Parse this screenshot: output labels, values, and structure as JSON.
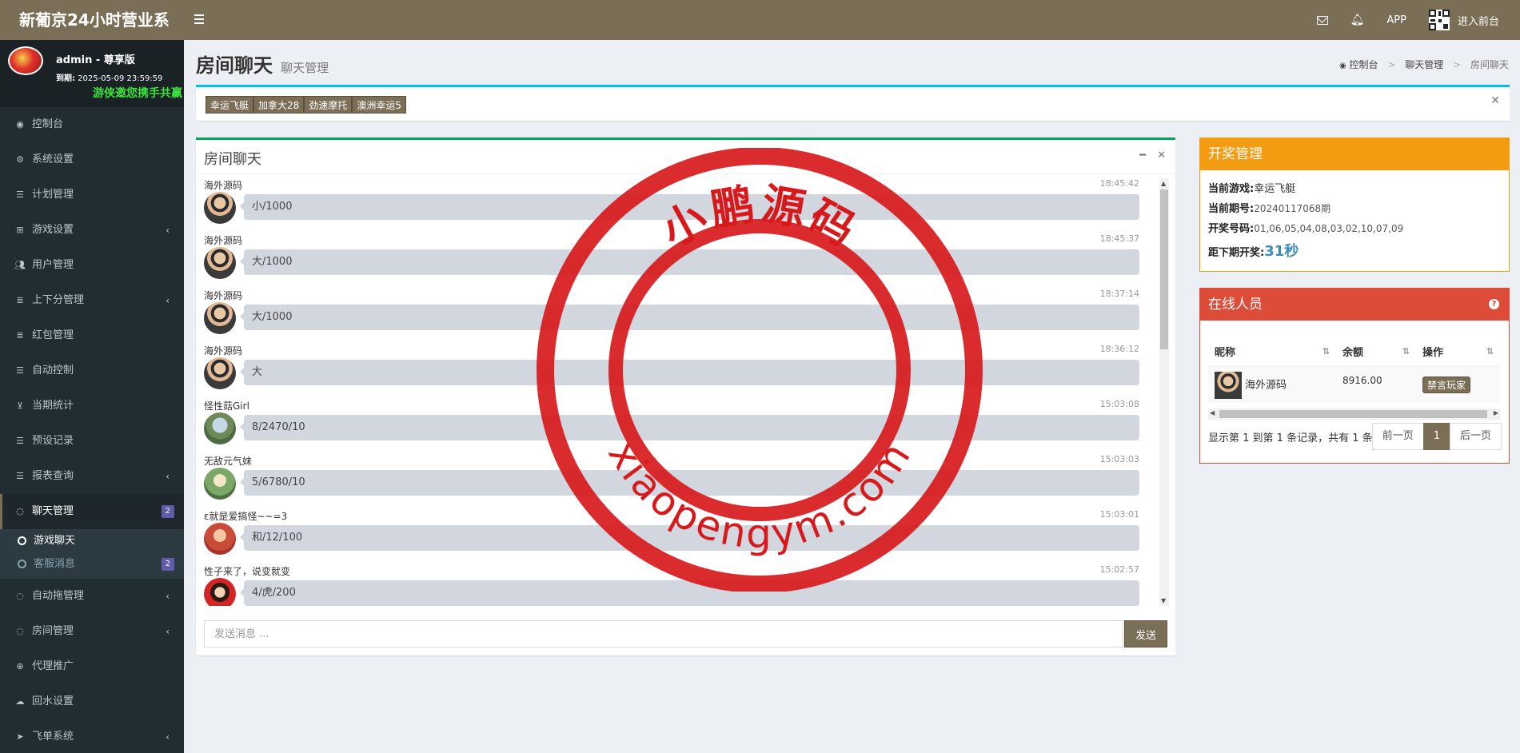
{
  "header": {
    "brand": "新葡京24小时营业系",
    "app_label": "APP",
    "front_label": "进入前台"
  },
  "user": {
    "name": "admin",
    "role": "尊享版",
    "expiry_label": "到期:",
    "expiry": "2025-05-09 23:59:59",
    "marquee": "游侠邀您携手共赢"
  },
  "menu": [
    {
      "label": "控制台",
      "icon": "dashboard-icon"
    },
    {
      "label": "系统设置",
      "icon": "cogs-icon"
    },
    {
      "label": "计划管理",
      "icon": "list-icon"
    },
    {
      "label": "游戏设置",
      "icon": "gamepad-icon",
      "chevron": true
    },
    {
      "label": "用户管理",
      "icon": "users-icon"
    },
    {
      "label": "上下分管理",
      "icon": "database-icon",
      "chevron": true
    },
    {
      "label": "红包管理",
      "icon": "database-icon"
    },
    {
      "label": "自动控制",
      "icon": "list-icon"
    },
    {
      "label": "当期统计",
      "icon": "cart-icon"
    },
    {
      "label": "预设记录",
      "icon": "list-icon"
    },
    {
      "label": "报表查询",
      "icon": "list-icon",
      "chevron": true
    },
    {
      "label": "聊天管理",
      "icon": "comments-icon",
      "badge": "2",
      "active": true
    },
    {
      "label": "自动拖管理",
      "icon": "comment-icon",
      "chevron": true
    },
    {
      "label": "房间管理",
      "icon": "comments-icon",
      "chevron": true
    },
    {
      "label": "代理推广",
      "icon": "user-plus-icon"
    },
    {
      "label": "回水设置",
      "icon": "cloud-download-icon"
    },
    {
      "label": "飞单系统",
      "icon": "paper-plane-icon",
      "chevron": true
    }
  ],
  "submenu": [
    {
      "label": "游戏聊天",
      "active": true
    },
    {
      "label": "客服消息",
      "badge": "2"
    }
  ],
  "page": {
    "title": "房间聊天",
    "subtitle": "聊天管理",
    "breadcrumb": [
      "控制台",
      "聊天管理",
      "房间聊天"
    ]
  },
  "tabs": [
    "幸运飞艇",
    "加拿大28",
    "劲速摩托",
    "澳洲幸运5"
  ],
  "chat": {
    "title": "房间聊天",
    "messages": [
      {
        "name": "海外源码",
        "time": "18:45:42",
        "text": "小/1000",
        "avatar": "av-man"
      },
      {
        "name": "海外源码",
        "time": "18:45:37",
        "text": "大/1000",
        "avatar": "av-man"
      },
      {
        "name": "海外源码",
        "time": "18:37:14",
        "text": "大/1000",
        "avatar": "av-man"
      },
      {
        "name": "海外源码",
        "time": "18:36:12",
        "text": "大",
        "avatar": "av-man"
      },
      {
        "name": "怪性菇Girl",
        "time": "15:03:08",
        "text": "8/2470/10",
        "avatar": "av-girl"
      },
      {
        "name": "无敌元气妹",
        "time": "15:03:03",
        "text": "5/6780/10",
        "avatar": "av-kid"
      },
      {
        "name": "ε就是爱搞怪~~=3",
        "time": "15:03:01",
        "text": "和/12/100",
        "avatar": "av-rose"
      },
      {
        "name": "性子来了，说变就变",
        "time": "15:02:57",
        "text": "4/虎/200",
        "avatar": "av-red"
      }
    ],
    "placeholder": "发送消息 ...",
    "send_label": "发送"
  },
  "lottery": {
    "title": "开奖管理",
    "game_label": "当前游戏:",
    "game": "幸运飞艇",
    "period_label": "当前期号:",
    "period": "20240117068期",
    "numbers_label": "开奖号码:",
    "numbers": "01,06,05,04,08,03,02,10,07,09",
    "next_label": "距下期开奖:",
    "countdown": "31秒"
  },
  "online": {
    "title": "在线人员",
    "columns": [
      "昵称",
      "余额",
      "操作"
    ],
    "rows": [
      {
        "nickname": "海外源码",
        "balance": "8916.00",
        "action": "禁言玩家"
      }
    ],
    "page_info": "显示第 1 到第 1 条记录，共有 1 条记录",
    "prev": "前一页",
    "current": "1",
    "next": "后一页"
  },
  "watermark": {
    "top_text": "小鹏源码",
    "bottom_text": "xiaopengym.com"
  },
  "colors": {
    "header": "#7b6e56",
    "sidebar": "#222d32",
    "lottery": "#f39c12",
    "online": "#dd4b39",
    "stamp": "#d7191c"
  }
}
